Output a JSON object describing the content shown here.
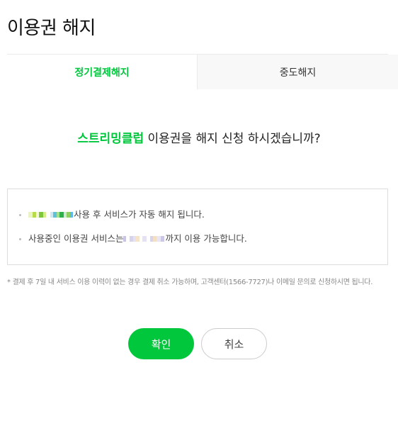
{
  "page": {
    "title": "이용권 해지"
  },
  "tabs": [
    {
      "label": "정기결제해지",
      "active": true
    },
    {
      "label": "중도해지",
      "active": false
    }
  ],
  "question": {
    "brand": "스트리밍클럽",
    "text": " 이용권을 해지 신청 하시겠습니까?"
  },
  "notices": [
    {
      "text": "사용 후 서비스가 자동 해지 됩니다."
    },
    {
      "prefix": "사용중인 이용권 서비스는 ",
      "suffix": "까지 이용 가능합니다."
    }
  ],
  "footnote": "* 결제 후 7일 내 서비스 이용 이력이 없는 경우 결제 취소 가능하며, 고객센터(1566-7727)나 이메일 문의로 신청하시면 됩니다.",
  "buttons": {
    "confirm": "확인",
    "cancel": "취소"
  },
  "colors": {
    "accent": "#00c73c",
    "tab_inactive_bg": "#f8f8f8",
    "border": "#dddddd"
  }
}
